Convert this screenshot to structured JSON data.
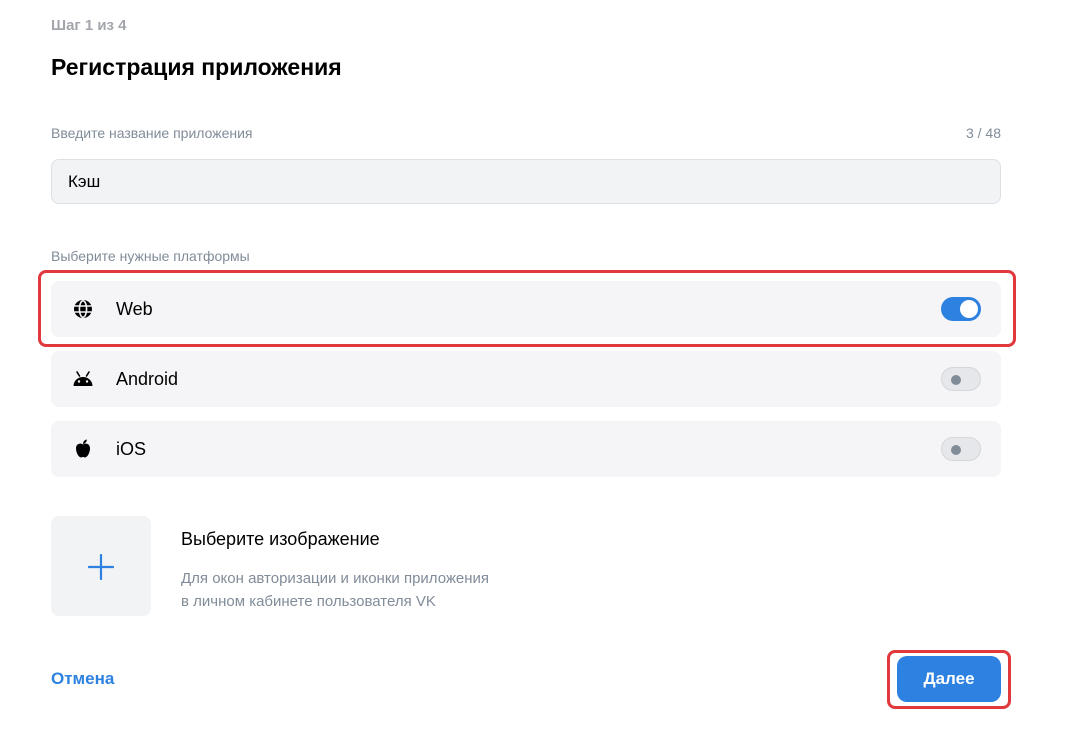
{
  "header": {
    "step": "Шаг 1 из 4",
    "title": "Регистрация приложения"
  },
  "app_name": {
    "label": "Введите название приложения",
    "counter": "3 / 48",
    "value": "Кэш"
  },
  "platforms": {
    "label": "Выберите нужные платформы",
    "items": [
      {
        "name": "Web",
        "icon": "globe-icon",
        "enabled": true
      },
      {
        "name": "Android",
        "icon": "android-icon",
        "enabled": false
      },
      {
        "name": "iOS",
        "icon": "apple-icon",
        "enabled": false
      }
    ]
  },
  "image": {
    "title": "Выберите изображение",
    "description_line1": "Для окон авторизации и иконки приложения",
    "description_line2": "в личном кабинете пользователя VK",
    "icon": "plus-icon"
  },
  "footer": {
    "cancel_label": "Отмена",
    "next_label": "Далее"
  },
  "colors": {
    "accent": "#2d81e0",
    "highlight": "#e0383c",
    "secondary_text": "#818c99"
  }
}
